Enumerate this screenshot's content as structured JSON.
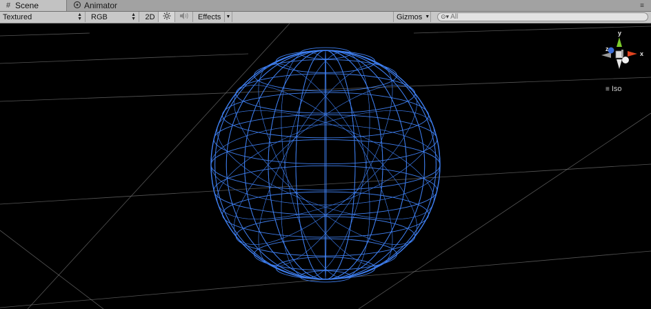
{
  "tabs": [
    {
      "label": "Scene",
      "icon": "grid-icon",
      "active": true
    },
    {
      "label": "Animator",
      "icon": "animator-icon",
      "active": false
    }
  ],
  "toolbar": {
    "draw_mode": "Textured",
    "render_mode": "RGB",
    "toggle_2d": "2D",
    "effects": "Effects",
    "gizmos": "Gizmos",
    "search_placeholder": "All"
  },
  "gizmo": {
    "axis_y": "y",
    "axis_z": "z",
    "axis_x": "x",
    "projection": "Iso"
  },
  "colors": {
    "wire": "#3f7ff0",
    "grid": "#7a7a7a",
    "axis_x": "#e0431f",
    "axis_y": "#7ccc2c",
    "axis_z": "#3c6ed8"
  }
}
